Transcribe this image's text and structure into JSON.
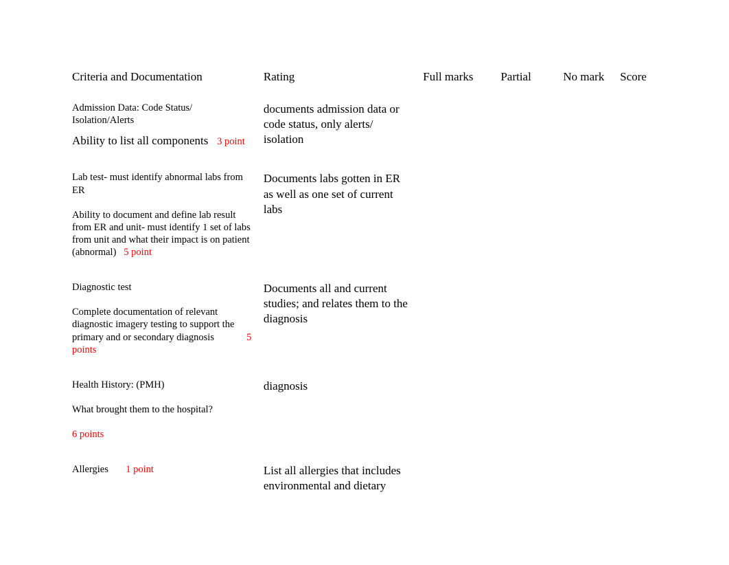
{
  "headers": {
    "criteria": "Criteria and Documentation",
    "rating": "Rating",
    "full": "Full marks",
    "partial": "Partial",
    "nomark": "No mark",
    "score": "Score"
  },
  "rows": [
    {
      "title": "Admission Data: Code Status/ Isolation/Alerts",
      "sub_lead": "Ability to list all components",
      "sub_rest": "",
      "points": "3 point",
      "sub_big": true,
      "rating": "documents admission data or code status, only alerts/ isolation"
    },
    {
      "title": "Lab test- must identify abnormal labs from ER",
      "sub_lead": "",
      "sub_rest": "Ability to document    and define lab result from ER and unit- must identify 1 set of labs from unit and what their impact is on patient (abnormal)",
      "points": "5 point",
      "sub_big": false,
      "rating": "Documents labs gotten in ER as well as one set of current labs"
    },
    {
      "title": "Diagnostic test",
      "sub_lead": "",
      "sub_rest": "Complete documentation of relevant diagnostic imagery testing    to support the primary and or secondary diagnosis",
      "points": "5 points",
      "points_trail": true,
      "sub_big": false,
      "rating": "Documents all and  current studies; and relates them to the diagnosis"
    },
    {
      "title": "Health History: (PMH)",
      "sub_lead": "",
      "sub_rest": "What brought them to the hospital?",
      "points": "6 points",
      "points_own_line": true,
      "sub_big": false,
      "rating": "diagnosis",
      "rating_mid": true
    },
    {
      "title_inline": "Allergies",
      "points": "1 point",
      "inline": true,
      "rating": "List all allergies that includes environmental and dietary"
    }
  ]
}
